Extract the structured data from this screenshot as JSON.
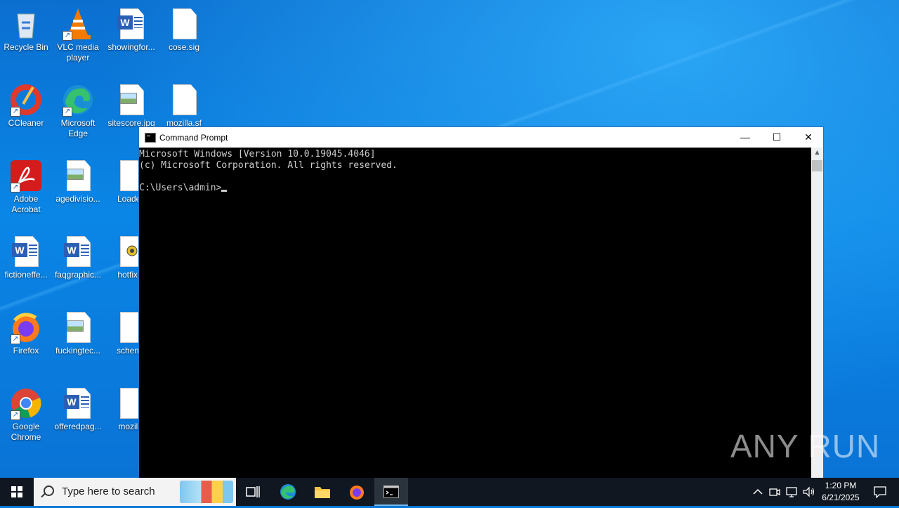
{
  "desktop": {
    "icons": [
      {
        "label": "Recycle Bin",
        "icon": "recycle-bin-icon"
      },
      {
        "label": "VLC media player",
        "icon": "vlc-icon"
      },
      {
        "label": "showingfor...",
        "icon": "word-document-icon"
      },
      {
        "label": "cose.sig",
        "icon": "file-icon"
      },
      {
        "label": "CCleaner",
        "icon": "ccleaner-icon"
      },
      {
        "label": "Microsoft Edge",
        "icon": "edge-icon"
      },
      {
        "label": "sitescore.jpg",
        "icon": "image-file-icon"
      },
      {
        "label": "mozilla.sf",
        "icon": "file-icon"
      },
      {
        "label": "Adobe Acrobat",
        "icon": "acrobat-icon"
      },
      {
        "label": "agedivisio...",
        "icon": "image-file-icon"
      },
      {
        "label": "Loader.",
        "icon": "file-icon"
      },
      {
        "label": "fictioneffe...",
        "icon": "word-document-icon"
      },
      {
        "label": "faqgraphic...",
        "icon": "word-document-icon"
      },
      {
        "label": "hotfix-ir",
        "icon": "config-file-icon"
      },
      {
        "label": "Firefox",
        "icon": "firefox-icon"
      },
      {
        "label": "fuckingtec...",
        "icon": "image-file-icon"
      },
      {
        "label": "schema",
        "icon": "file-icon"
      },
      {
        "label": "Google Chrome",
        "icon": "chrome-icon"
      },
      {
        "label": "offeredpag...",
        "icon": "word-document-icon"
      },
      {
        "label": "mozilla",
        "icon": "file-icon"
      }
    ]
  },
  "cmd": {
    "title": "Command Prompt",
    "lines": [
      "Microsoft Windows [Version 10.0.19045.4046]",
      "(c) Microsoft Corporation. All rights reserved.",
      "",
      "C:\\Users\\admin>"
    ],
    "minimize": "—",
    "maximize": "☐",
    "close": "✕"
  },
  "watermark": "ANY RUN",
  "taskbar": {
    "search_placeholder": "Type here to search",
    "time": "1:20 PM",
    "date": "6/21/2025"
  }
}
